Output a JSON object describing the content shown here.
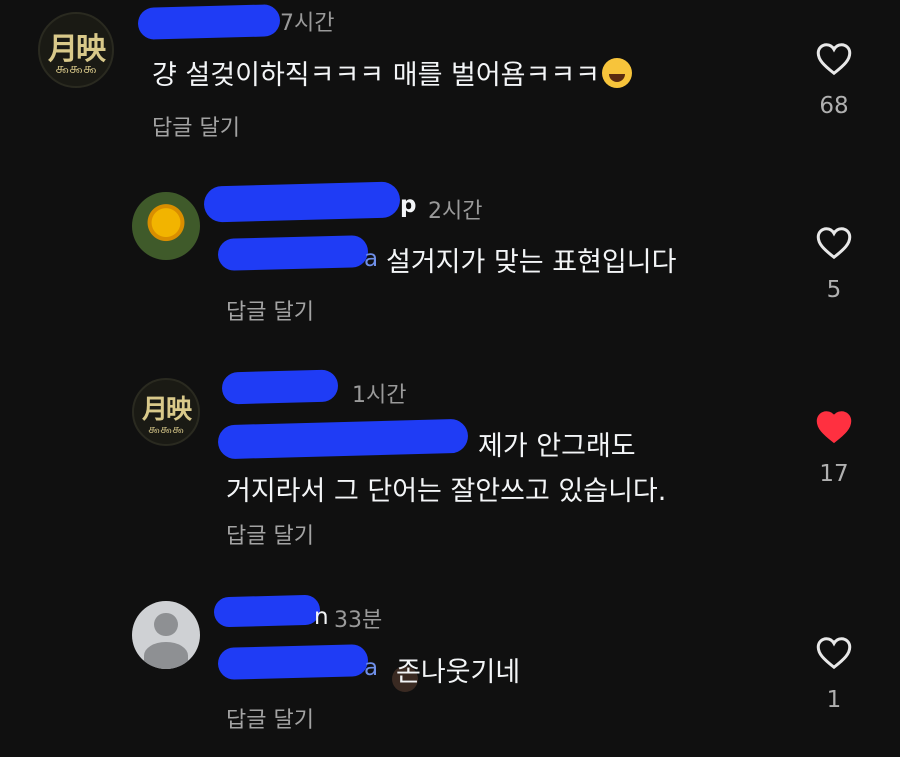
{
  "comments": [
    {
      "time": "7시간",
      "text": "걍 설겆이하직ㅋㅋㅋ 매를 벌어욤ㅋㅋㅋ",
      "emoji": "face-with-tears-of-joy",
      "reply_label": "답글 달기",
      "likes": "68",
      "liked": false,
      "avatar": "seal-avatar",
      "seal_glyphs": "月映",
      "seal_clouds": "௯௯௯"
    },
    {
      "name_tail": "p",
      "time": "2시간",
      "mention_tail": "a",
      "text": "설거지가 맞는 표현입니다",
      "reply_label": "답글 달기",
      "likes": "5",
      "liked": false,
      "avatar": "flower-avatar"
    },
    {
      "time": "1시간",
      "text_line1": "제가 안그래도",
      "text_line2": "거지라서 그 단어는 잘안쓰고 있습니다.",
      "reply_label": "답글 달기",
      "likes": "17",
      "liked": true,
      "avatar": "seal-avatar",
      "seal_glyphs": "月映",
      "seal_clouds": "௯௯௯"
    },
    {
      "name_tail": "n",
      "time": "33분",
      "mention_tail": "a",
      "text": "존나웃기네",
      "reply_label": "답글 달기",
      "likes": "1",
      "liked": false,
      "avatar": "default-avatar"
    }
  ],
  "colors": {
    "background": "#101010",
    "redaction": "#1f3cf5",
    "liked_heart": "#ff3040",
    "muted_text": "#9a9a9a"
  }
}
